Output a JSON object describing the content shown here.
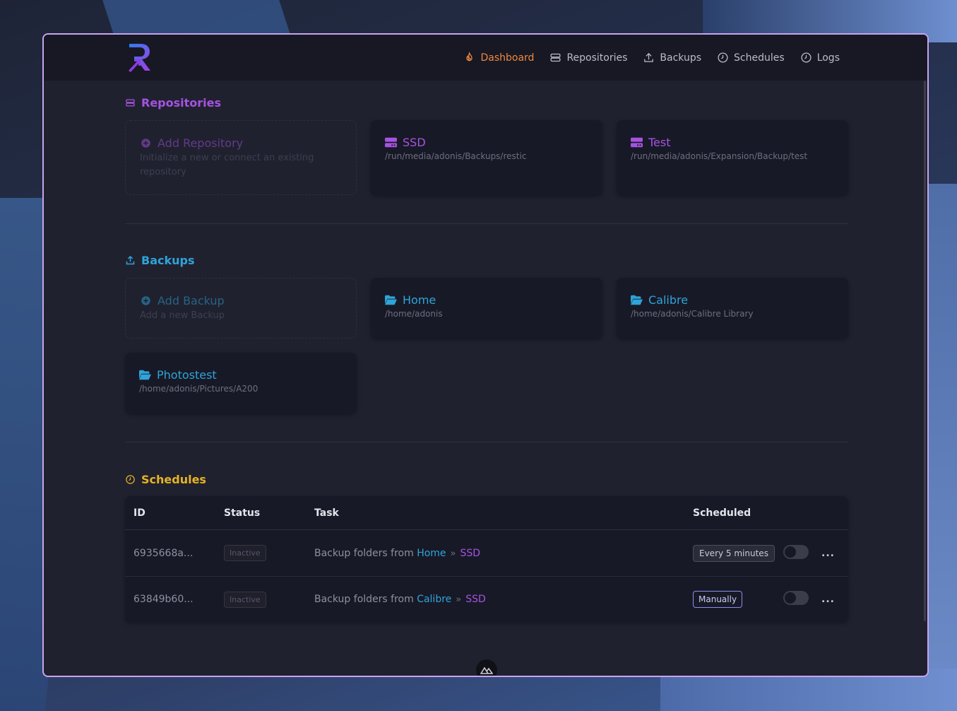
{
  "colors": {
    "accent_orange": "#f0883e",
    "repositories": "#a653e0",
    "backups": "#2ea4d9",
    "schedules": "#e6b422",
    "window_border": "#c7a4ee"
  },
  "nav": {
    "links": [
      {
        "label": "Dashboard",
        "icon": "flame-icon",
        "active": true
      },
      {
        "label": "Repositories",
        "icon": "database-icon"
      },
      {
        "label": "Backups",
        "icon": "upload-icon"
      },
      {
        "label": "Schedules",
        "icon": "clock-icon"
      },
      {
        "label": "Logs",
        "icon": "clock-icon"
      }
    ]
  },
  "repositories": {
    "title": "Repositories",
    "add": {
      "title": "Add Repository",
      "subtitle": "Initialize a new or connect an existing repository"
    },
    "items": [
      {
        "name": "SSD",
        "path": "/run/media/adonis/Backups/restic"
      },
      {
        "name": "Test",
        "path": "/run/media/adonis/Expansion/Backup/test"
      }
    ]
  },
  "backups": {
    "title": "Backups",
    "add": {
      "title": "Add Backup",
      "subtitle": "Add a new Backup"
    },
    "items": [
      {
        "name": "Home",
        "path": "/home/adonis"
      },
      {
        "name": "Calibre",
        "path": "/home/adonis/Calibre Library"
      },
      {
        "name": "Photostest",
        "path": "/home/adonis/Pictures/A200"
      }
    ]
  },
  "schedules": {
    "title": "Schedules",
    "columns": {
      "id": "ID",
      "status": "Status",
      "task": "Task",
      "scheduled": "Scheduled"
    },
    "rows": [
      {
        "id": "6935668a...",
        "status": "Inactive",
        "task_prefix": "Backup folders from",
        "source": "Home",
        "target": "SSD",
        "scheduled": "Every 5 minutes",
        "enabled": false
      },
      {
        "id": "63849b60...",
        "status": "Inactive",
        "task_prefix": "Backup folders from",
        "source": "Calibre",
        "target": "SSD",
        "scheduled": "Manually",
        "enabled": false
      }
    ]
  },
  "menu_label": "..."
}
